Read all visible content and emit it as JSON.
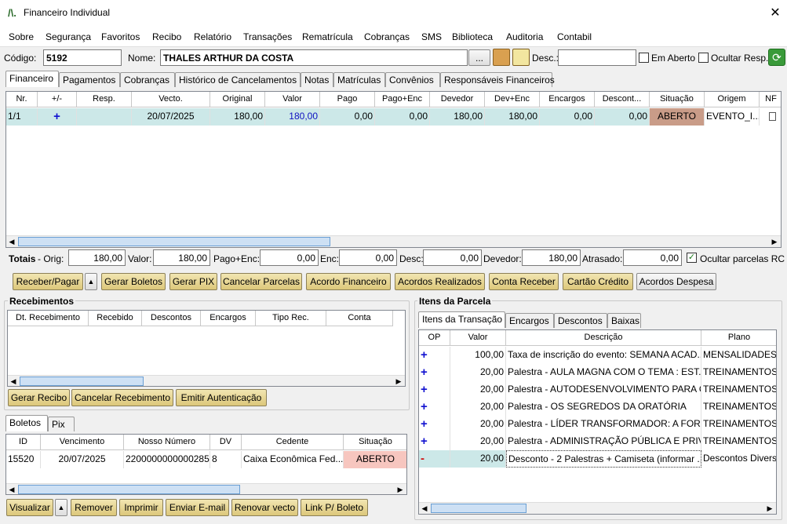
{
  "window": {
    "title": "Financeiro Individual",
    "logo": "/\\."
  },
  "menu": [
    "Sobre",
    "Segurança",
    "Favoritos",
    "Recibo",
    "Relatório",
    "Transações",
    "Rematrícula",
    "Cobranças",
    "SMS",
    "Biblioteca",
    "Auditoria",
    "Contabil"
  ],
  "header": {
    "codigo_label": "Código:",
    "codigo": "5192",
    "nome_label": "Nome:",
    "nome": "THALES ARTHUR DA COSTA",
    "browse": "...",
    "desc_label": "Desc.:",
    "desc": "",
    "em_aberto": "Em Aberto",
    "ocultar_resp": "Ocultar Resp."
  },
  "tabs": [
    "Financeiro",
    "Pagamentos",
    "Cobranças",
    "Histórico de Cancelamentos",
    "Notas",
    "Matrículas",
    "Convênios",
    "Responsáveis Financeiros"
  ],
  "fin_grid": {
    "headers": [
      "Nr.",
      "+/-",
      "Resp.",
      "Vecto.",
      "Original",
      "Valor",
      "Pago",
      "Pago+Enc",
      "Devedor",
      "Dev+Enc",
      "Encargos",
      "Descont...",
      "Situação",
      "Origem",
      "NF"
    ],
    "row": {
      "nr": "1/1",
      "pm": "+",
      "resp": "",
      "vecto": "20/07/2025",
      "original": "180,00",
      "valor": "180,00",
      "pago": "0,00",
      "pagoenc": "0,00",
      "devedor": "180,00",
      "devenc": "180,00",
      "encargos": "0,00",
      "desconto": "0,00",
      "situacao": "ABERTO",
      "origem": "EVENTO_I..."
    }
  },
  "totais": {
    "label": "Totais",
    "orig_label": "- Orig:",
    "orig": "180,00",
    "valor_label": "Valor:",
    "valor": "180,00",
    "pagoenc_label": "Pago+Enc:",
    "pagoenc": "0,00",
    "enc_label": "Enc:",
    "enc": "0,00",
    "desc_label": "Desc:",
    "desc": "0,00",
    "devedor_label": "Devedor:",
    "devedor": "180,00",
    "atrasado_label": "Atrasado:",
    "atrasado": "0,00",
    "ocultar": "Ocultar parcelas RC"
  },
  "actions": [
    "Receber/Pagar",
    "Gerar Boletos",
    "Gerar PIX",
    "Cancelar Parcelas",
    "Acordo Financeiro",
    "Acordos Realizados",
    "Conta Receber",
    "Cartão Crédito",
    "Acordos Despesa"
  ],
  "recebimentos": {
    "title": "Recebimentos",
    "headers": [
      "Dt. Recebimento",
      "Recebido",
      "Descontos",
      "Encargos",
      "Tipo Rec.",
      "Conta"
    ],
    "buttons": [
      "Gerar Recibo",
      "Cancelar Recebimento",
      "Emitir Autenticação"
    ]
  },
  "boletos": {
    "tabs": [
      "Boletos",
      "Pix"
    ],
    "headers": [
      "ID",
      "Vencimento",
      "Nosso Número",
      "DV",
      "Cedente",
      "Situação"
    ],
    "row": {
      "id": "15520",
      "venc": "20/07/2025",
      "nosso": "22000000000002856",
      "dv": "8",
      "cedente": "Caixa Econômica Fed...",
      "situacao": "ABERTO"
    },
    "buttons": [
      "Visualizar",
      "Remover",
      "Imprimir",
      "Enviar E-mail",
      "Renovar vecto",
      "Link P/ Boleto"
    ]
  },
  "itens": {
    "title": "Itens da Parcela",
    "tabs": [
      "Itens da Transação",
      "Encargos",
      "Descontos",
      "Baixas"
    ],
    "headers": [
      "OP",
      "Valor",
      "Descrição",
      "Plano"
    ],
    "rows": [
      {
        "op": "+",
        "valor": "100,00",
        "desc": "Taxa de inscrição do evento: SEMANA ACAD...",
        "plano": "MENSALIDADES E"
      },
      {
        "op": "+",
        "valor": "20,00",
        "desc": "Palestra - AULA MAGNA COM O TEMA : EST...",
        "plano": "TREINAMENTOS E"
      },
      {
        "op": "+",
        "valor": "20,00",
        "desc": "Palestra - AUTODESENVOLVIMENTO PARA O...",
        "plano": "TREINAMENTOS E"
      },
      {
        "op": "+",
        "valor": "20,00",
        "desc": "Palestra - OS SEGREDOS DA ORATÓRIA",
        "plano": "TREINAMENTOS E"
      },
      {
        "op": "+",
        "valor": "20,00",
        "desc": "Palestra - LÍDER TRANSFORMADOR: A FORÇ...",
        "plano": "TREINAMENTOS E"
      },
      {
        "op": "+",
        "valor": "20,00",
        "desc": "Palestra - ADMINISTRAÇÃO PÚBLICA E PRIV...",
        "plano": "TREINAMENTOS E"
      },
      {
        "op": "-",
        "valor": "20,00",
        "desc": "Desconto - 2 Palestras + Camiseta (informar ...",
        "plano": "Descontos Diverso"
      }
    ]
  },
  "colors": {
    "selected_row": "#cce8e8",
    "aberto": "#c99c88",
    "aberto_boleto": "#f7c6bf",
    "button": "#e6d796"
  }
}
